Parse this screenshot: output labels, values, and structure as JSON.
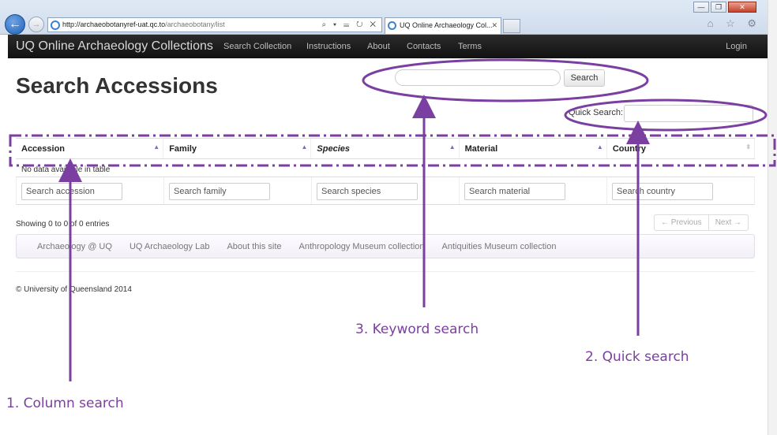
{
  "browser": {
    "url_domain": "http://archaeobotanyref-uat.qc.to",
    "url_path": "/archaeobotany/list",
    "address_tools": "⌕ ▾ ☰ ↻ ✕",
    "tab_title": "UQ Online Archaeology Col...",
    "tab_close": "✕",
    "back_glyph": "←",
    "forward_glyph": "→",
    "min_glyph": "—",
    "max_glyph": "❐",
    "close_glyph": "✕",
    "right_icons": "⌂ ☆ ⚙"
  },
  "navbar": {
    "brand": "UQ Online Archaeology Collections",
    "items": [
      "Search Collection",
      "Instructions",
      "About",
      "Contacts",
      "Terms"
    ],
    "login": "Login"
  },
  "page": {
    "title": "Search Accessions",
    "keyword_search": {
      "value": "",
      "button": "Search"
    },
    "quick_search": {
      "label": "Quick Search:",
      "value": ""
    }
  },
  "table": {
    "columns": [
      {
        "label": "Accession",
        "sort_glyph": "▲"
      },
      {
        "label": "Family",
        "sort_glyph": "▲"
      },
      {
        "label": "Species",
        "sort_glyph": "▲"
      },
      {
        "label": "Material",
        "sort_glyph": "▲"
      },
      {
        "label": "Country",
        "sort_glyph": "⬍"
      }
    ],
    "empty_message": "No data available in table",
    "filter_placeholders": [
      "Search accession",
      "Search family",
      "Search species",
      "Search material",
      "Search country"
    ]
  },
  "pagination": {
    "info": "Showing 0 to 0 of 0 entries",
    "previous": "← Previous",
    "next": "Next →"
  },
  "footer": {
    "links": [
      "Archaeology @ UQ",
      "UQ Archaeology Lab",
      "About this site",
      "Anthropology Museum collection",
      "Antiquities Museum collection"
    ],
    "copyright": "© University of Queensland 2014"
  },
  "annotations": {
    "column_search": "1. Column search",
    "quick_search": "2. Quick search",
    "keyword_search": "3. Keyword search",
    "color": "#7a3fa0"
  }
}
